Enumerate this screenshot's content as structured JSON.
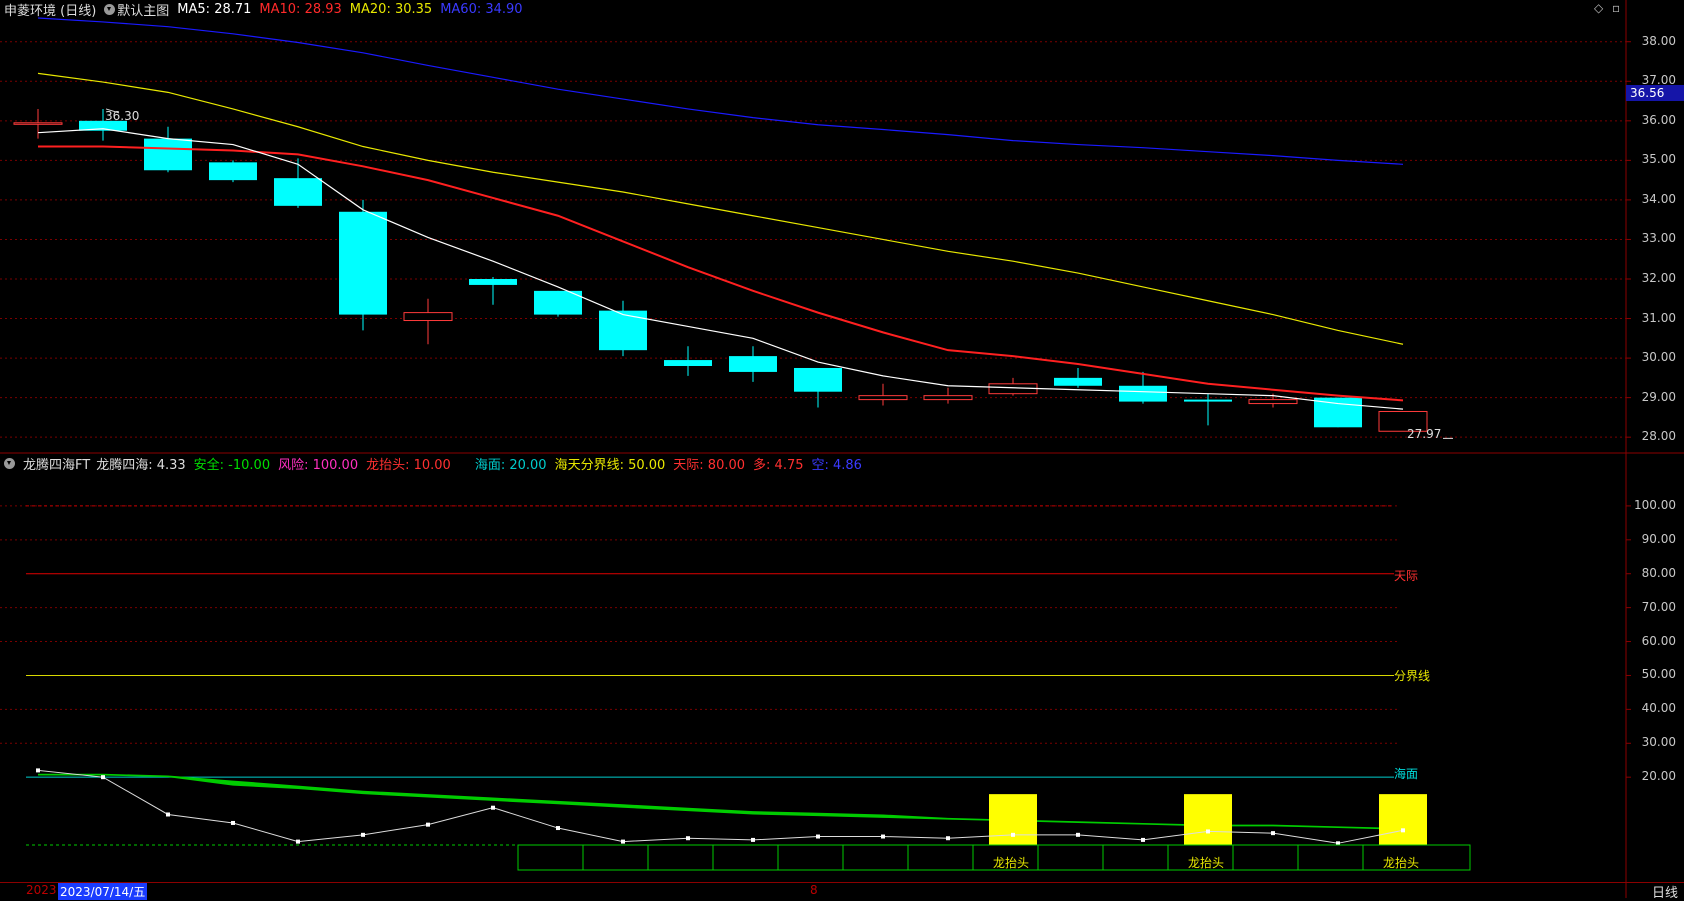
{
  "header": {
    "stock_title": "申菱环境 (日线)",
    "chart_mode": "默认主图",
    "ma5": "MA5: 28.71",
    "ma10": "MA10: 28.93",
    "ma20": "MA20: 30.35",
    "ma60": "MA60: 34.90"
  },
  "indicator_header": {
    "name": "龙腾四海FT",
    "value": "龙腾四海: 4.33",
    "safe": "安全: -10.00",
    "risk": "风险: 100.00",
    "dragon_head": "龙抬头: 10.00",
    "sea": "海面: 20.00",
    "divider": "海天分界线: 50.00",
    "sky": "天际: 80.00",
    "long": "多: 4.75",
    "short": "空: 4.86"
  },
  "price_axis": [
    "38.00",
    "37.00",
    "36.00",
    "35.00",
    "34.00",
    "33.00",
    "32.00",
    "31.00",
    "30.00",
    "29.00",
    "28.00"
  ],
  "price_badge": "36.56",
  "high_label": "36.30",
  "low_label": "27.97",
  "indicator_axis": [
    "100.00",
    "90.00",
    "80.00",
    "70.00",
    "60.00",
    "50.00",
    "40.00",
    "30.00",
    "20.00"
  ],
  "line_labels": {
    "sky": "天际",
    "divider": "分界线",
    "sea": "海面"
  },
  "signal_label": "龙抬头",
  "date_left": "2023",
  "date_selected": "2023/07/14/五",
  "date_mid": "8",
  "period": "日线",
  "colors": {
    "up": "#ff3b3b",
    "down": "#00ffff",
    "ma5": "#ffffff",
    "ma10": "#ff2020",
    "ma20": "#e8e800",
    "ma60": "#1a1aff",
    "sky": "#e00000",
    "divider": "#d8d800",
    "sea": "#00cccc",
    "band": "#00cc00",
    "signal": "#ffff00"
  },
  "chart_data": [
    {
      "type": "candlestick",
      "title": "申菱环境 (日线)",
      "ylim": [
        27.6,
        38.6
      ],
      "candles": [
        {
          "o": 35.95,
          "h": 36.3,
          "l": 35.55,
          "c": 35.95
        },
        {
          "o": 36.0,
          "h": 36.3,
          "l": 35.5,
          "c": 35.75
        },
        {
          "o": 35.55,
          "h": 35.85,
          "l": 34.7,
          "c": 34.75
        },
        {
          "o": 34.95,
          "h": 35.0,
          "l": 34.45,
          "c": 34.5
        },
        {
          "o": 34.55,
          "h": 35.05,
          "l": 33.8,
          "c": 33.85
        },
        {
          "o": 33.7,
          "h": 34.0,
          "l": 30.7,
          "c": 31.1
        },
        {
          "o": 30.95,
          "h": 31.5,
          "l": 30.35,
          "c": 31.15
        },
        {
          "o": 32.0,
          "h": 32.05,
          "l": 31.35,
          "c": 31.85
        },
        {
          "o": 31.7,
          "h": 31.7,
          "l": 31.05,
          "c": 31.1
        },
        {
          "o": 31.2,
          "h": 31.45,
          "l": 30.05,
          "c": 30.2
        },
        {
          "o": 29.95,
          "h": 30.3,
          "l": 29.55,
          "c": 29.8
        },
        {
          "o": 30.05,
          "h": 30.3,
          "l": 29.4,
          "c": 29.65
        },
        {
          "o": 29.75,
          "h": 29.75,
          "l": 28.75,
          "c": 29.15
        },
        {
          "o": 28.95,
          "h": 29.35,
          "l": 28.8,
          "c": 29.05
        },
        {
          "o": 28.95,
          "h": 29.25,
          "l": 28.85,
          "c": 29.05
        },
        {
          "o": 29.1,
          "h": 29.5,
          "l": 29.05,
          "c": 29.35
        },
        {
          "o": 29.5,
          "h": 29.75,
          "l": 29.25,
          "c": 29.3
        },
        {
          "o": 29.3,
          "h": 29.65,
          "l": 28.85,
          "c": 28.9
        },
        {
          "o": 28.95,
          "h": 29.1,
          "l": 28.3,
          "c": 28.9
        },
        {
          "o": 28.85,
          "h": 29.1,
          "l": 28.75,
          "c": 28.95
        },
        {
          "o": 29.0,
          "h": 29.0,
          "l": 28.25,
          "c": 28.25
        },
        {
          "o": 28.15,
          "h": 28.65,
          "l": 28.15,
          "c": 28.65
        }
      ],
      "ma5": [
        35.7,
        35.8,
        35.55,
        35.4,
        34.9,
        33.75,
        33.05,
        32.45,
        31.8,
        31.1,
        30.8,
        30.5,
        29.9,
        29.55,
        29.3,
        29.25,
        29.2,
        29.15,
        29.1,
        29.05,
        28.85,
        28.71
      ],
      "ma10": [
        35.35,
        35.35,
        35.3,
        35.25,
        35.15,
        34.85,
        34.5,
        34.05,
        33.6,
        32.95,
        32.3,
        31.7,
        31.15,
        30.65,
        30.2,
        30.05,
        29.85,
        29.6,
        29.35,
        29.2,
        29.05,
        28.93
      ],
      "ma20": [
        37.2,
        36.98,
        36.72,
        36.3,
        35.85,
        35.35,
        35.0,
        34.7,
        34.45,
        34.2,
        33.9,
        33.6,
        33.3,
        33.0,
        32.7,
        32.45,
        32.15,
        31.8,
        31.45,
        31.1,
        30.7,
        30.35
      ],
      "ma60": [
        38.6,
        38.5,
        38.38,
        38.2,
        37.98,
        37.72,
        37.4,
        37.1,
        36.8,
        36.55,
        36.3,
        36.08,
        35.9,
        35.78,
        35.65,
        35.5,
        35.4,
        35.32,
        35.22,
        35.12,
        35.0,
        34.9
      ]
    },
    {
      "type": "line",
      "title": "龙腾四海FT",
      "ylim": [
        0,
        110
      ],
      "main": [
        22,
        20,
        9,
        6.5,
        1,
        3,
        6,
        11,
        5,
        1,
        2,
        1.5,
        2.5,
        2.5,
        2,
        3,
        3,
        1.5,
        4,
        3.5,
        0.5,
        4.33
      ],
      "band_top": [
        21,
        21,
        20.5,
        19,
        17.5,
        16,
        15,
        14,
        13,
        12,
        11,
        10,
        9.5,
        9,
        8,
        7.5,
        7,
        6.5,
        6,
        6,
        5.5,
        5
      ],
      "band_bottom": [
        20.5,
        20.5,
        20,
        17.5,
        16.5,
        15,
        14,
        13,
        12,
        11,
        10,
        9,
        8.5,
        8,
        7.5,
        7,
        6.5,
        6,
        5.5,
        5.5,
        5,
        4.5
      ],
      "signals": [
        15,
        18,
        21
      ],
      "signal_value": 15,
      "sea": 20,
      "divider": 50,
      "sky": 80,
      "risk": 100
    }
  ]
}
